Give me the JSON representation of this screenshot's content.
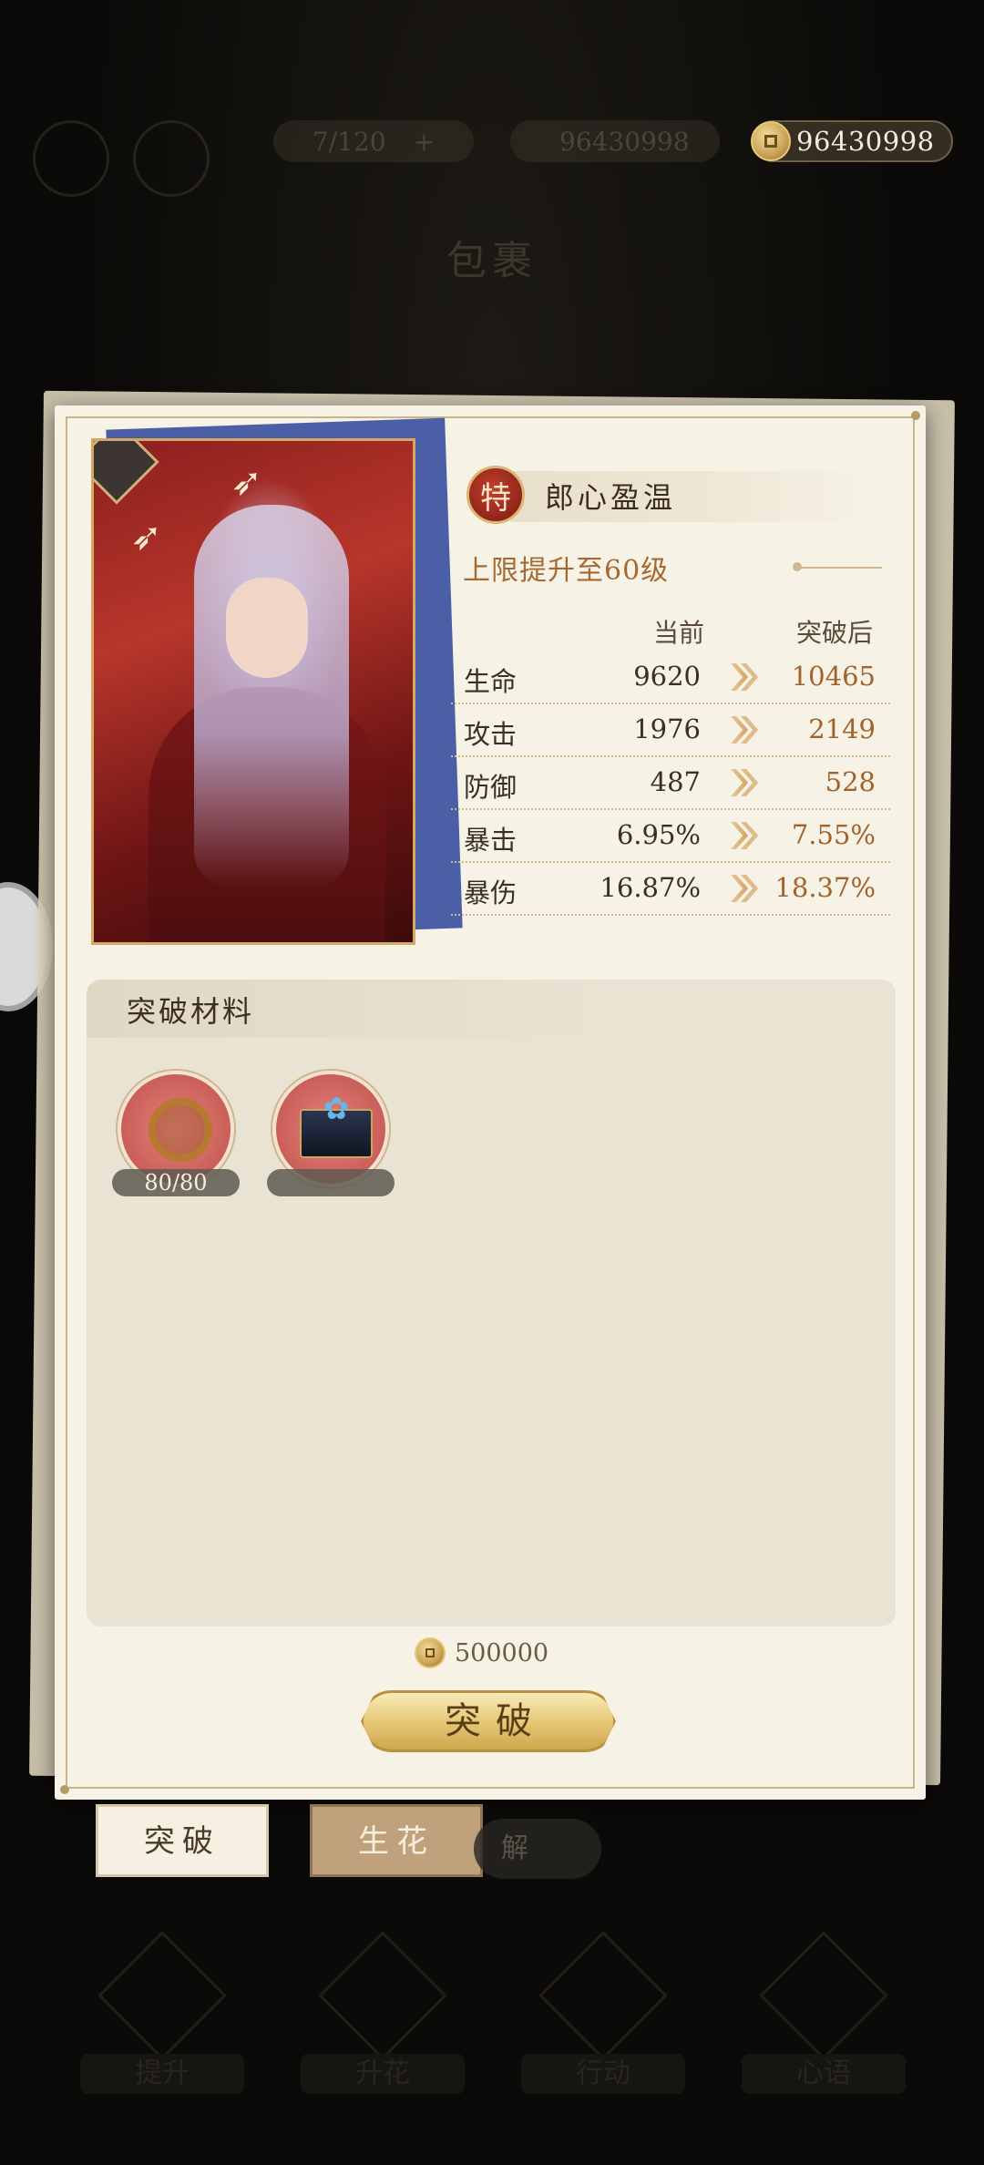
{
  "top_bar": {
    "slots_text": "7/120",
    "dim_currency": "96430998",
    "currency_value": "96430998"
  },
  "background_title": "包裹",
  "card": {
    "name_badge": "特",
    "name": "郎心盈温",
    "limit_text": "上限提升至60级"
  },
  "stats": {
    "headers": {
      "current": "当前",
      "after": "突破后"
    },
    "rows": [
      {
        "label": "生命",
        "current": "9620",
        "after": "10465"
      },
      {
        "label": "攻击",
        "current": "1976",
        "after": "2149"
      },
      {
        "label": "防御",
        "current": "487",
        "after": "528"
      },
      {
        "label": "暴击",
        "current": "6.95%",
        "after": "7.55%"
      },
      {
        "label": "暴伤",
        "current": "16.87%",
        "after": "18.37%"
      }
    ]
  },
  "materials": {
    "title": "突破材料",
    "items": [
      {
        "icon": "ring-material-icon",
        "count": "80/80"
      },
      {
        "icon": "chest-material-icon",
        "count": ""
      }
    ]
  },
  "cost": {
    "value": "500000"
  },
  "break_button": {
    "label": "突破"
  },
  "tabs": [
    {
      "label": "突破",
      "active": true
    },
    {
      "label": "生花",
      "active": false
    }
  ],
  "dim_pill_text": "解",
  "nav": [
    "提升",
    "升花",
    "行动",
    "心语"
  ],
  "colors": {
    "panel": "#f6f2e6",
    "accent_gold": "#e7c977",
    "after_value": "#a2632b",
    "badge_red": "#8a2116"
  }
}
